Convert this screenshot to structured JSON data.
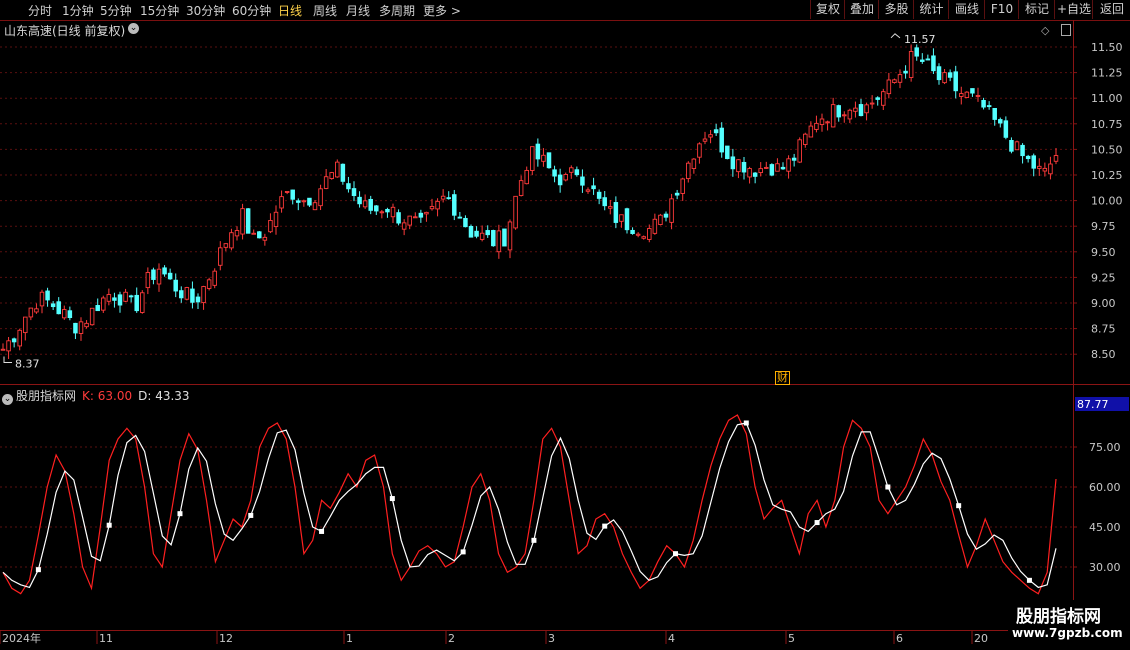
{
  "toolbar": {
    "periods": [
      "分时",
      "1分钟",
      "5分钟",
      "15分钟",
      "30分钟",
      "60分钟",
      "日线",
      "周线",
      "月线",
      "多周期",
      "更多 >"
    ],
    "active_period": "日线",
    "right_buttons": [
      "复权",
      "叠加",
      "多股",
      "统计",
      "画线",
      "F10",
      "标记",
      "+自选",
      "返回"
    ]
  },
  "main_chart": {
    "title": "山东高速(日线 前复权)",
    "high_label": "11.57",
    "low_label": "8.37",
    "axis_ticks": [
      "11.50",
      "11.25",
      "11.00",
      "10.75",
      "10.50",
      "10.25",
      "10.00",
      "9.75",
      "9.50",
      "9.25",
      "9.00",
      "8.75",
      "8.50"
    ],
    "finance_marker": "财",
    "up_color": "#ff3b3b",
    "down_color": "#54ffff"
  },
  "indicator": {
    "name": "股朋指标网",
    "k_label": "K: 63.00",
    "d_label": "D: 43.33",
    "highlight_value": "87.77",
    "axis_ticks": [
      "75.00",
      "60.00",
      "45.00",
      "30.00"
    ],
    "k_color": "#ff2020",
    "d_color": "#ffffff"
  },
  "x_axis": {
    "labels": [
      "2024年",
      "11",
      "12",
      "1",
      "2",
      "3",
      "4",
      "5",
      "6",
      "20"
    ]
  },
  "watermark": {
    "line1": "股朋指标网",
    "line2": "www.7gpzb.com"
  },
  "chart_data": {
    "type": "candlestick",
    "title": "山东高速(日线 前复权)",
    "ylim": [
      8.37,
      11.57
    ],
    "y_ticks": [
      8.5,
      8.75,
      9.0,
      9.25,
      9.5,
      9.75,
      10.0,
      10.25,
      10.5,
      10.75,
      11.0,
      11.25,
      11.5
    ],
    "period_high": 11.57,
    "period_low": 8.37,
    "x_labels": [
      "2024年",
      "11",
      "12",
      "1",
      "2",
      "3",
      "4",
      "5",
      "6",
      "20"
    ],
    "close_path": [
      8.55,
      8.7,
      8.9,
      9.05,
      9.0,
      8.9,
      8.78,
      8.85,
      9.0,
      9.1,
      9.05,
      8.95,
      9.2,
      9.35,
      9.2,
      9.1,
      9.0,
      9.2,
      9.45,
      9.7,
      9.85,
      9.6,
      9.7,
      9.95,
      10.1,
      10.0,
      10.05,
      10.2,
      10.3,
      10.1,
      9.95,
      9.9,
      9.95,
      9.85,
      9.8,
      9.75,
      9.9,
      10.05,
      9.9,
      9.7,
      9.65,
      9.6,
      9.65,
      10.1,
      10.45,
      10.4,
      10.25,
      10.2,
      10.3,
      10.15,
      9.95,
      9.85,
      9.78,
      9.75,
      9.72,
      9.8,
      10.05,
      10.3,
      10.55,
      10.7,
      10.55,
      10.4,
      10.35,
      10.3,
      10.35,
      10.3,
      10.4,
      10.6,
      10.8,
      10.85,
      10.9,
      10.95,
      10.9,
      11.0,
      11.1,
      11.25,
      11.4,
      11.35,
      11.2,
      11.15,
      11.05,
      11.0,
      10.9,
      10.75,
      10.6,
      10.45,
      10.35,
      10.25,
      10.45
    ],
    "indicator": {
      "name": "股朋指标网",
      "K": 63.0,
      "D": 43.33,
      "current_level": 87.77,
      "ylim": [
        20,
        90
      ],
      "y_ticks": [
        30,
        45,
        60,
        75
      ],
      "K_path": [
        28,
        22,
        20,
        25,
        42,
        60,
        72,
        66,
        50,
        30,
        22,
        45,
        70,
        78,
        82,
        78,
        60,
        35,
        30,
        50,
        70,
        80,
        74,
        55,
        32,
        40,
        48,
        45,
        55,
        75,
        82,
        84,
        78,
        60,
        35,
        40,
        55,
        52,
        58,
        65,
        60,
        70,
        72,
        60,
        35,
        25,
        30,
        36,
        38,
        35,
        30,
        32,
        45,
        60,
        65,
        55,
        35,
        28,
        30,
        35,
        55,
        78,
        82,
        75,
        55,
        35,
        38,
        48,
        50,
        45,
        35,
        28,
        22,
        25,
        32,
        38,
        35,
        30,
        40,
        55,
        68,
        78,
        85,
        87,
        80,
        60,
        48,
        52,
        55,
        45,
        35,
        50,
        55,
        45,
        55,
        75,
        85,
        82,
        75,
        55,
        50,
        55,
        60,
        68,
        78,
        72,
        62,
        55,
        42,
        30,
        38,
        48,
        40,
        32,
        28,
        25,
        22,
        20,
        28,
        63
      ]
    }
  }
}
